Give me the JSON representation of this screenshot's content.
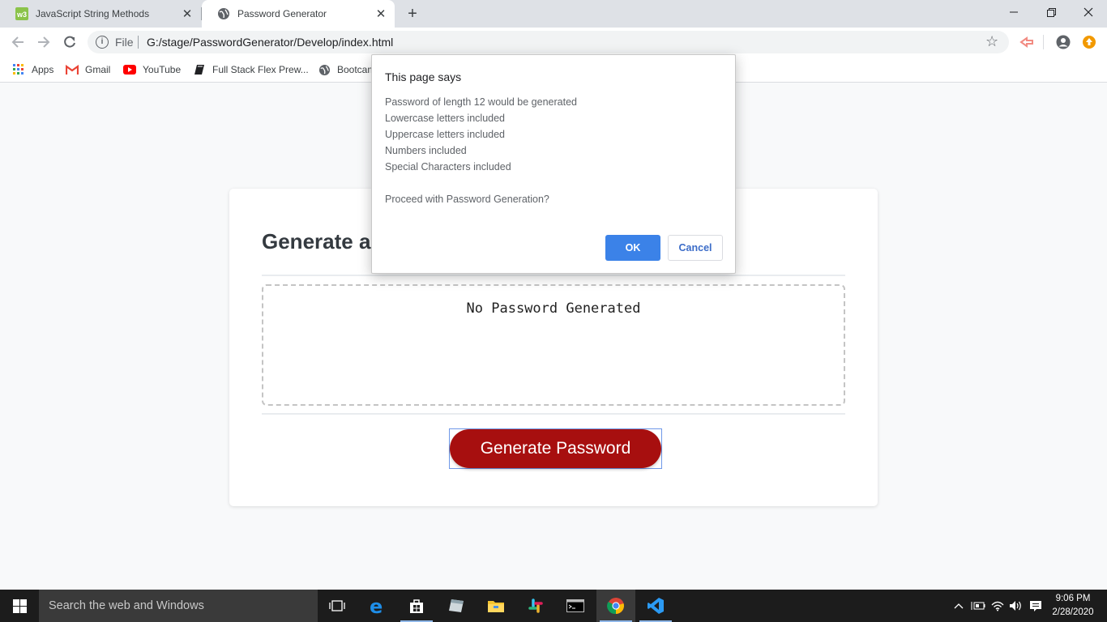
{
  "browser": {
    "tabs": [
      {
        "title": "JavaScript String Methods",
        "favicon": "w3schools-icon"
      },
      {
        "title": "Password Generator",
        "favicon": "globe-icon"
      }
    ],
    "address_bar": {
      "scheme_label": "File",
      "url": "G:/stage/PasswordGenerator/Develop/index.html"
    },
    "bookmarks": [
      {
        "label": "Apps",
        "icon": "apps-grid-icon"
      },
      {
        "label": "Gmail",
        "icon": "gmail-icon"
      },
      {
        "label": "YouTube",
        "icon": "youtube-icon"
      },
      {
        "label": "Full Stack Flex Prew...",
        "icon": "book-icon"
      },
      {
        "label": "Bootcam",
        "icon": "globe-icon"
      }
    ]
  },
  "page": {
    "title": "Generate a",
    "password_placeholder": "No Password Generated",
    "generate_button": "Generate Password",
    "accent_color": "#a70f0f"
  },
  "dialog": {
    "title": "This page says",
    "lines": [
      "Password of length 12 would be generated",
      "Lowercase letters included",
      "Uppercase letters included",
      "Numbers included",
      "Special Characters included"
    ],
    "question": "Proceed with Password Generation?",
    "ok_label": "OK",
    "cancel_label": "Cancel"
  },
  "taskbar": {
    "search_placeholder": "Search the web and Windows",
    "time": "9:06 PM",
    "date": "2/28/2020",
    "apps": [
      "task-view-icon",
      "edge-icon",
      "store-icon",
      "app-icon",
      "file-explorer-icon",
      "slack-icon",
      "terminal-icon",
      "chrome-icon",
      "vscode-icon"
    ]
  }
}
